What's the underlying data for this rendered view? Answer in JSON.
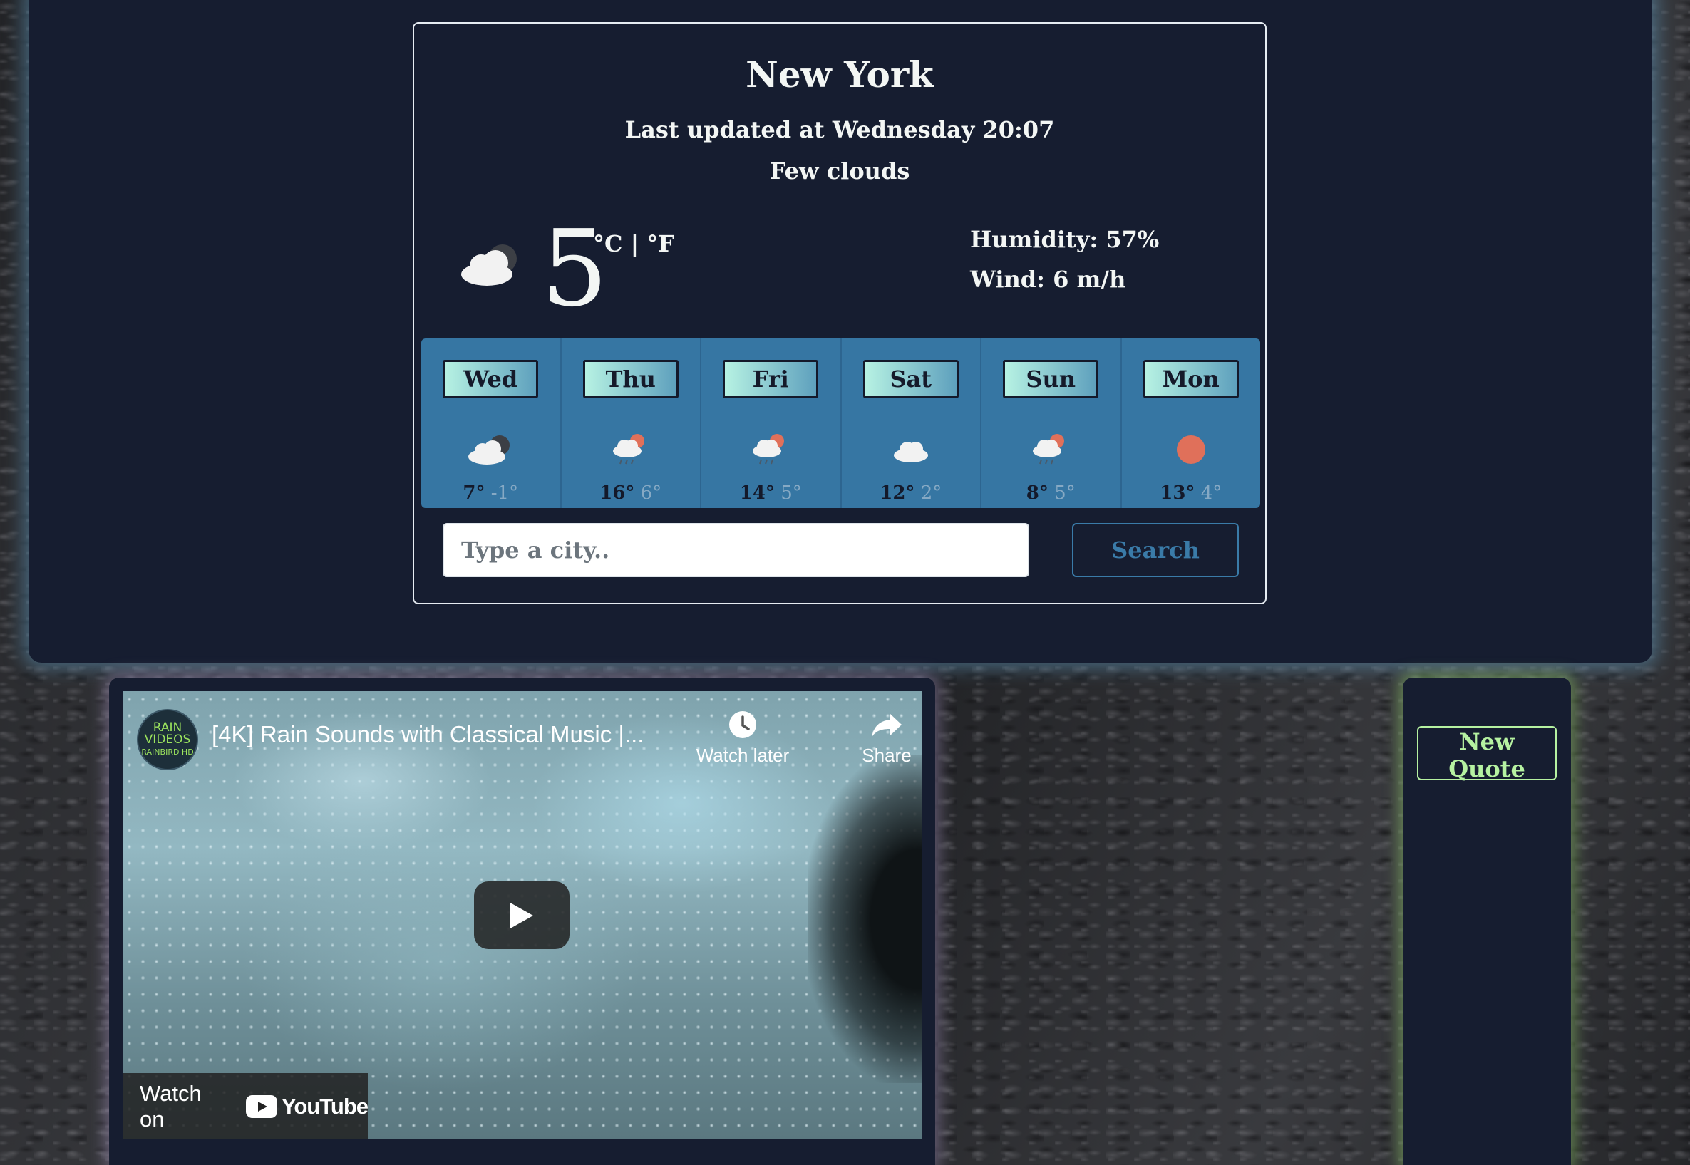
{
  "weather": {
    "city": "New York",
    "last_updated": "Last updated at Wednesday 20:07",
    "description": "Few clouds",
    "current_icon": "few-clouds-night-icon",
    "temperature": "5",
    "units": "°C | °F",
    "humidity": "Humidity: 57%",
    "wind": "Wind: 6 m/h"
  },
  "forecast": [
    {
      "day": "Wed",
      "icon": "few-clouds-night-icon",
      "max": "7°",
      "min": "-1°"
    },
    {
      "day": "Thu",
      "icon": "rain-sun-icon",
      "max": "16°",
      "min": "6°"
    },
    {
      "day": "Fri",
      "icon": "rain-sun-icon",
      "max": "14°",
      "min": "5°"
    },
    {
      "day": "Sat",
      "icon": "cloud-icon",
      "max": "12°",
      "min": "2°"
    },
    {
      "day": "Sun",
      "icon": "rain-sun-icon",
      "max": "8°",
      "min": "5°"
    },
    {
      "day": "Mon",
      "icon": "sun-icon",
      "max": "13°",
      "min": "4°"
    }
  ],
  "search": {
    "placeholder": "Type a city..",
    "button_label": "Search"
  },
  "video": {
    "channel_logo_lines": [
      "RAIN",
      "VIDEOS",
      "RAINBIRD HD"
    ],
    "title": "[4K] Rain Sounds with Classical Music |...",
    "watch_later": "Watch later",
    "share": "Share",
    "watch_on": "Watch on",
    "youtube": "YouTube"
  },
  "quote": {
    "button_label": "New Quote"
  },
  "colors": {
    "panel": "#161d30",
    "forecast_bg": "#3676a3",
    "accent_blue": "#3a7ba8",
    "quote_green": "#b6f2a1",
    "sun": "#e0705a"
  }
}
